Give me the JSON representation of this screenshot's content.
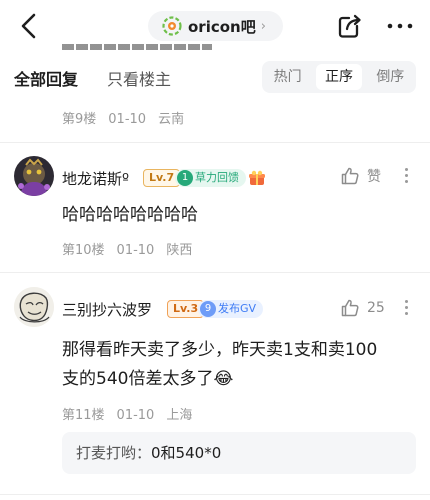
{
  "nav": {
    "forum_name": "oricon吧",
    "chevron": "›",
    "back_icon": "back-arrow-icon",
    "share_icon": "share-icon",
    "more_icon": "more-dots-icon"
  },
  "filters": {
    "all_label": "全部回复",
    "host_label": "只看楼主",
    "sort_options": [
      "热门",
      "正序",
      "倒序"
    ],
    "active_sort": "正序"
  },
  "prev_floor": {
    "floor": "第9楼",
    "date": "01-10",
    "location": "云南"
  },
  "posts": [
    {
      "username": "地龙诺斯º",
      "level": "Lv.7",
      "tag": "草力回馈",
      "tag_color": "#27a97a",
      "content": "哈哈哈哈哈哈哈哈",
      "like_text": "赞",
      "floor": "第10楼",
      "date": "01-10",
      "location": "陕西"
    },
    {
      "username": "三别抄六波罗",
      "level": "Lv.3",
      "tag_num": "9",
      "tag": "发布GV",
      "tag_color": "#3e7cf5",
      "content_line1": "那得看昨天卖了多少，昨天卖1支和卖100",
      "content_line2": "支的540倍差太多了",
      "emoji": "😂",
      "like_text": "25",
      "floor": "第11楼",
      "date": "01-10",
      "location": "上海",
      "sub_reply": {
        "user": "打麦打哟：",
        "text": "0和540*0"
      }
    }
  ]
}
